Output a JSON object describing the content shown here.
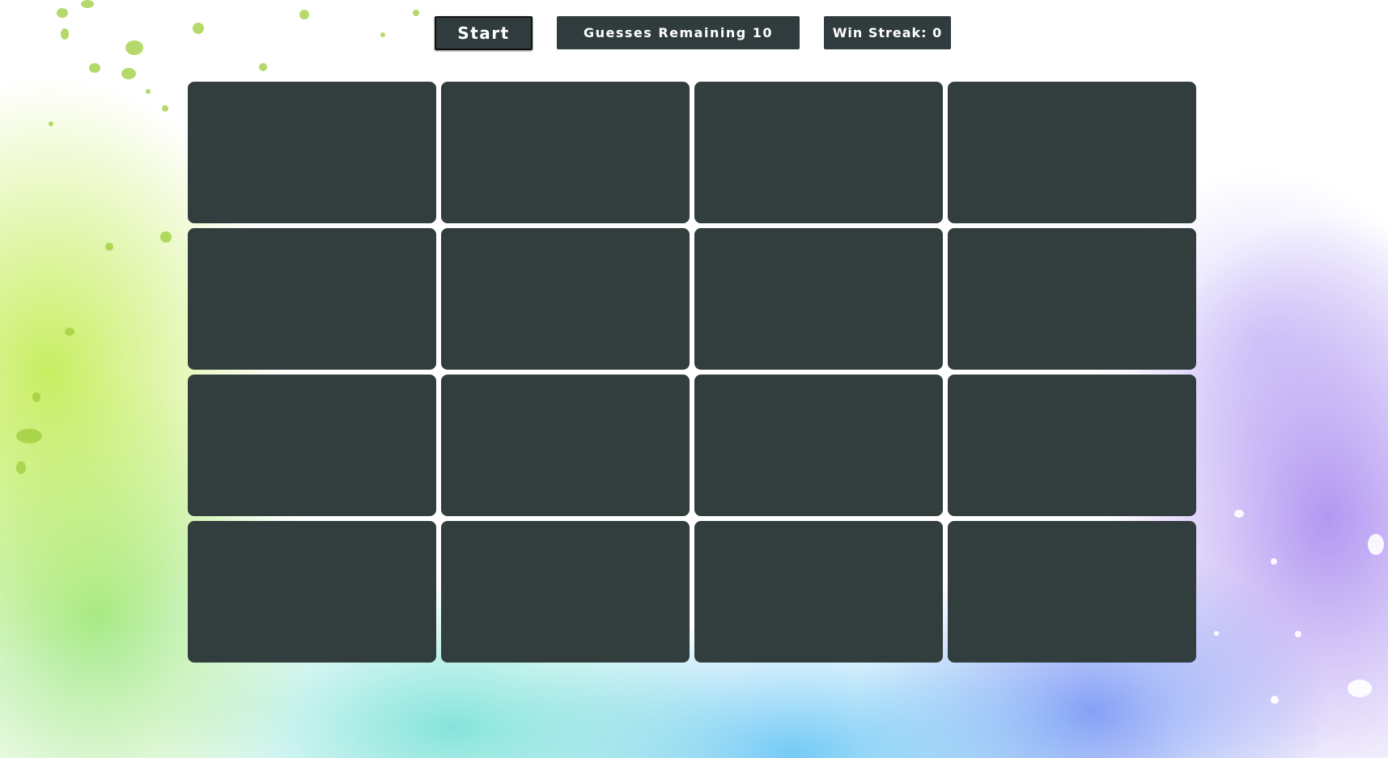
{
  "controls": {
    "start_label": "Start",
    "guesses_label": "Guesses Remaining 10",
    "streak_label": "Win Streak: 0"
  },
  "board": {
    "rows": 4,
    "columns": 4,
    "cards_face_down": 16
  },
  "colors": {
    "control_bg": "#2f3b3c",
    "card_back": "#323d3e",
    "text": "#ffffff"
  }
}
